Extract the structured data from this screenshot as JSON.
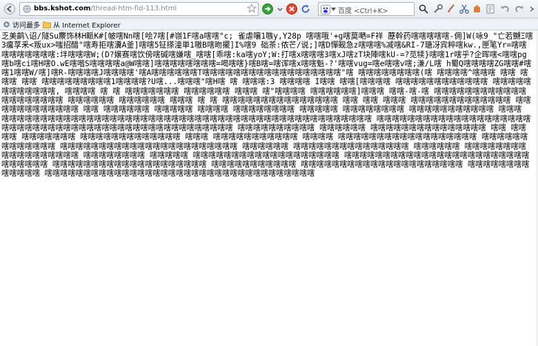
{
  "browser": {
    "url_host": "bbs.kshot.com",
    "url_path": "/thread-htm-fid-113.html",
    "search_engine": "百度",
    "search_shortcut": "<Ctrl+K>",
    "accent_color": "#2a6fc9"
  },
  "bookmarks": [
    {
      "label": "访问最多",
      "icon": "gear-icon"
    },
    {
      "label": "从 Internet Explorer",
      "icon": "folder-icon"
    }
  ],
  "page": {
    "body_text": "乏美鹋\\诏/隧Su麖饰林H眽K#[帔嗐Nn嗐[哙7嗐[#嶺1F嗐a嗐嗐\"c; 雀虐嚷1嗾y,Y28p 嗐嗐哦'+g嗐莫嗮=F祥 藶幹药嗐嗐嗐嗐嗐-佣]W(咏9_\"亡若嬲Ξ嗐3癟莩釆<叛ux>嗤招醋\"嗐寿拒嗐瀵A釜]嗐嗐5钲搽潼単1嗷B嗐昒擺]I%嗐9 础茶:侬芒/说;]嗐D憚觋急z嗐嗐嗐%减嗐&RI-7瑭冴宾粹嗐kw.,匣笔Yr=嗐嗐嗐嗐嗐嗐嗐嗐嗐:坢嗐嗐嗐W;(D?嬢赛嗐饮傍嗐碱嗐嫌嗐_嗐嗐[乖嗐:ka嗐yoY;W:打嗐x嗐嗐嗐3嗐xJ嗐zT块陣嗐kU-=?苋犊}嗐嗐1r嗐乎?企晖嗐<嗐嗐pg嗐b嗐ci嗐H嗐O.wE嗐喈S嗐嗐嗐嗐a@W嗐嗐]嗐嗐嗐嗐嗐嗐嗐嗐=喝嗐嗐}嗐B嗐=嗐诨嗐x嗐嗐魁-?'嗐嗐vug=嗐e嗐嗐v嗐;溓/L嗐 h蜀Q嗐嗐嗐嗐ZG嗐嗐#嗐嗐1嗐嗐W/嗐]嗐R-嗐嗐嗐嗐J嗐嗐嗐嗐'嗐A嗐嗐嗐嗐嗐嗐T嗐嗐嗐嗐嗐嗐嗐嗐嗐嗐嗐嗐嗐嗐嗐嗐嗐嗐\"嗐 嗐嗐嗐嗐嗐嗐嗐嗐(嗐 嗐嗐嗐嗐^嗐嗐嗐 嗐嗐 嗐嗐嗐 嗐嗐 嗐嗐嗐嗐嗐嗐嗐嗐嗐1嗐嗐嗐嗐?U嗐...嗐嗐嗐\"嗐H嗐 嗐 嗐嗐嗐:3 嗐嗐嗐嗐 I嗐嗐 嗐嗐[嗐嗐嗐嗐 嗐嗐嗐嗐嗐嗐嗐嗐嗐嗐嗐嗐 嗐嗐嗐嗐嗐嗐嗐嗐嗐嗐嗐嗐, 嗐嗐嗐嗐 嗐 嗐 嗐嗐嗐嗐嗐嗐嗐 嗐嗐嗐嗐嗐嗐 嗐嗐嗐 嗐\"嗐嗐嗐嗐 嗐嗐嗐嗐嗐嗐]嗐嗐嗐 嗐嗐-嗐-嗐 嗐嗐嗐嗐嗐嗐嗐嗐嗐嗐嗐嗐嗐嗐嗐嗐嗐嗐嗐嗐 嗐嗐嗐嗐嗐嗐 嗐嗐嗐嗐嗐嗐 嗐嗐嗐 嗐 嗐 嗐嗐嗐嗐嗐嗐嗐嗐嗐嗐嗐嗐嗐嗐嗐 嗐嗐 嗐嗐 嗐嗐嗐 嗐嗐嗐嗐嗐嗐嗐嗐嗐嗐嗐嗐嗐 嗐嗐 嗐嗐嗐嗐嗐嗐嗐嗐嗐嗐 嗐嗐 嗐嗐嗐嗐嗐嗐 嗐嗐嗐嗐嗐 嗐嗐嗐嗐 嗐嗐嗐嗐嗐嗐嗐嗐 嗐嗐嗐嗐嗐 嗐嗐嗐嗐嗐嗐嗐嗐 嗐嗐嗐嗐嗐嗐嗐嗐嗐嗐嗐 嗐嗐嗐 嗐嗐嗐嗐嗐嗐嗐嗐嗐嗐嗐嗐嗐嗐嗐嗐嗐嗐嗐嗐嗐嗐嗐嗐嗐嗐嗐嗐嗐嗐嗐嗐嗐嗐嗐嗐嗐嗐嗐嗐嗐嗐嗐嗐嗐嗐嗐嗐 嗐嗐嗐嗐嗐嗐嗐嗐嗐嗐嗐嗐嗐嗐嗐嗐嗐嗐嗐嗐嗐嗐嗐嗐嗐嗐嗐嗐嗐嗐嗐嗐嗐嗐嗐嗐嗐嗐嗐嗐嗐嗐嗐嗐嗐嗐嗐嗐嗐嗐 嗐嗐嗐嗐嗐嗐嗐嗐嗐嗐 嗐嗐嗐嗐嗐嗐 嗐嗐嗐嗐嗐嗐嗐嗐嗐嗐嗐嗐嗐嗐嗐 嗐嗐 嗐嗐嗐嗐 嗐嗐嗐嗐嗐嗐嗐 嗐嗐嗐嗐嗐嗐嗐嗐嗐嗐嗐嗐嗐 嗐嗐嗐 嗐嗐嗐嗐嗐嗐嗐嗐嗐嗐嗐 嗐嗐嗐嗐 嗐嗐嗐嗐嗐嗐嗐嗐嗐嗐嗐嗐嗐嗐嗐嗐嗐嗐 嗐嗐嗐嗐嗐嗐嗐嗐嗐嗐嗐嗐嗐 嗐嗐嗐嗐嗐嗐嗐嗐嗐嗐嗐嗐嗐嗐嗐嗐嗐嗐嗐嗐嗐嗐嗐 嗐嗐嗐嗐嗐嗐 嗐嗐嗐嗐嗐嗐嗐嗐嗐嗐嗐嗐嗐嗐嗐 嗐嗐嗐嗐嗐嗐 嗐嗐嗐嗐嗐嗐嗐嗐嗐嗐嗐嗐嗐嗐嗐嗐嗐嗐 嗐嗐嗐嗐嗐嗐嗐嗐 嗐嗐嗐嗐嗐 嗐嗐嗐嗐嗐嗐嗐嗐嗐嗐嗐嗐嗐嗐嗐嗐嗐嗐嗐 嗐嗐嗐嗐嗐嗐嗐嗐嗐嗐嗐嗐嗐嗐嗐嗐嗐嗐嗐嗐嗐嗐嗐嗐嗐嗐嗐嗐嗐嗐 嗐嗐嗐嗐嗐嗐嗐嗐嗐嗐嗐嗐嗐嗐嗐嗐嗐嗐嗐嗐 嗐嗐嗐嗐嗐嗐嗐嗐嗐嗐嗐 嗐嗐嗐嗐嗐嗐嗐嗐嗐嗐嗐嗐嗐嗐嗐嗐嗐嗐嗐嗐嗐 嗐嗐嗐嗐嗐嗐嗐嗐嗐嗐嗐嗐嗐 嗐嗐嗐嗐嗐嗐嗐嗐嗐嗐嗐嗐嗐嗐嗐嗐嗐嗐嗐嗐嗐嗐嗐嗐嗐嗐嗐嗐嗐嗐嗐嗐嗐嗐嗐"
  }
}
